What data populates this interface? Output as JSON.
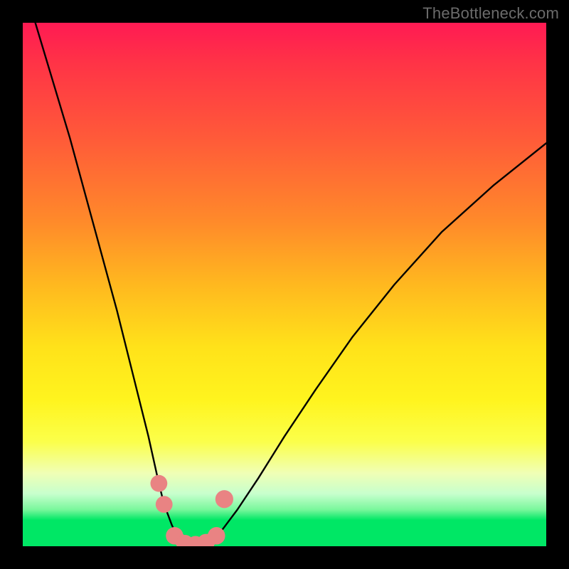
{
  "watermark": "TheBottleneck.com",
  "chart_data": {
    "type": "line",
    "title": "",
    "xlabel": "",
    "ylabel": "",
    "xlim": [
      0,
      100
    ],
    "ylim": [
      0,
      100
    ],
    "grid": false,
    "background_gradient": {
      "stops": [
        {
          "pos": 0,
          "color": "#ff1a53"
        },
        {
          "pos": 22,
          "color": "#ff5a39"
        },
        {
          "pos": 50,
          "color": "#ffb81f"
        },
        {
          "pos": 72,
          "color": "#fff41e"
        },
        {
          "pos": 90,
          "color": "#c7ffcd"
        },
        {
          "pos": 100,
          "color": "#00e765"
        }
      ]
    },
    "series": [
      {
        "name": "bottleneck-curve",
        "color": "#000000",
        "x": [
          0,
          3,
          6,
          9,
          12,
          15,
          18,
          21,
          24,
          26,
          27,
          28.5,
          30,
          32,
          34,
          36,
          38,
          41,
          45,
          50,
          56,
          63,
          71,
          80,
          90,
          100
        ],
        "y": [
          108,
          98,
          88,
          78,
          67,
          56,
          45,
          33,
          21,
          12,
          8,
          4,
          1,
          0,
          0,
          1,
          3,
          7,
          13,
          21,
          30,
          40,
          50,
          60,
          69,
          77
        ]
      }
    ],
    "markers": [
      {
        "name": "left-dot-1",
        "x": 26.0,
        "y": 12.0,
        "color": "#e98383",
        "r": 1.6
      },
      {
        "name": "left-dot-2",
        "x": 27.0,
        "y": 8.0,
        "color": "#e98383",
        "r": 1.6
      },
      {
        "name": "bottom-1",
        "x": 29.0,
        "y": 2.0,
        "color": "#e98383",
        "r": 1.7
      },
      {
        "name": "bottom-2",
        "x": 31.0,
        "y": 0.5,
        "color": "#e98383",
        "r": 1.7
      },
      {
        "name": "bottom-3",
        "x": 33.0,
        "y": 0.3,
        "color": "#e98383",
        "r": 1.7
      },
      {
        "name": "bottom-4",
        "x": 35.0,
        "y": 0.7,
        "color": "#e98383",
        "r": 1.7
      },
      {
        "name": "bottom-5",
        "x": 37.0,
        "y": 2.0,
        "color": "#e98383",
        "r": 1.7
      },
      {
        "name": "right-dot-1",
        "x": 38.5,
        "y": 9.0,
        "color": "#e98383",
        "r": 1.8
      }
    ]
  }
}
